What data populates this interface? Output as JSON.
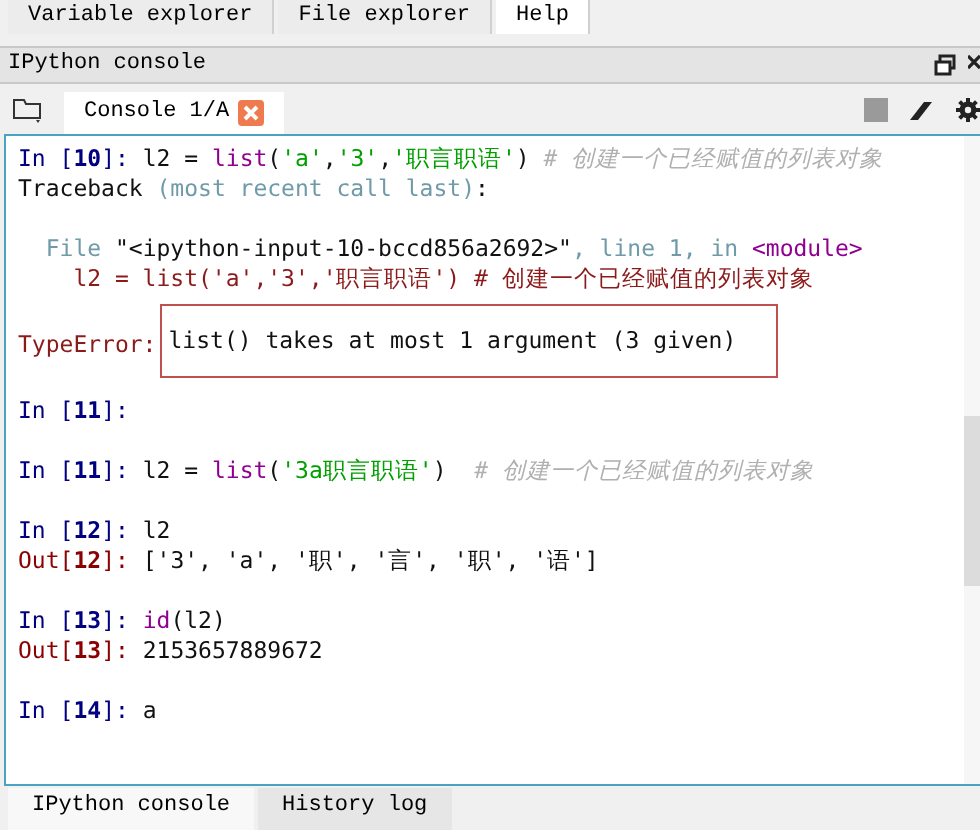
{
  "top_tabs": [
    {
      "label": "Variable explorer",
      "selected": false
    },
    {
      "label": "File explorer",
      "selected": false
    },
    {
      "label": "Help",
      "selected": true
    }
  ],
  "pane": {
    "title": "IPython console"
  },
  "console_tabs": [
    {
      "label": "Console 1/A",
      "selected": true
    }
  ],
  "console": {
    "blocks": [
      [
        {
          "kind": "code",
          "tokens": [
            {
              "kind": "in",
              "t": "In [**10**]: "
            },
            {
              "kind": "plain",
              "t": "l2 = "
            },
            {
              "kind": "builtin",
              "t": "list"
            },
            {
              "kind": "plain",
              "t": "("
            },
            {
              "kind": "string",
              "t": "'a'"
            },
            {
              "kind": "plain",
              "t": ","
            },
            {
              "kind": "string",
              "t": "'3'"
            },
            {
              "kind": "plain",
              "t": ","
            },
            {
              "kind": "string",
              "t": "'职言职语'"
            },
            {
              "kind": "plain",
              "t": ") "
            },
            {
              "kind": "comment",
              "t": "# 创建一个已经赋值的列表对象"
            }
          ]
        },
        {
          "kind": "code",
          "tokens": [
            {
              "kind": "plain",
              "t": "Traceback "
            },
            {
              "kind": "dim",
              "t": "(most recent call last)"
            },
            {
              "kind": "plain",
              "t": ":"
            }
          ]
        }
      ],
      [
        {
          "kind": "code",
          "tokens": [
            {
              "kind": "dim",
              "t": "  File "
            },
            {
              "kind": "plain",
              "t": "\"<ipython-input-10-bccd856a2692>\""
            },
            {
              "kind": "dim",
              "t": ", line 1, in "
            },
            {
              "kind": "builtin",
              "t": "<module>"
            }
          ]
        },
        {
          "kind": "code",
          "tokens": [
            {
              "kind": "error",
              "t": "    l2 = list('a','3','职言职语') # 创建一个已经赋值的列表对象"
            }
          ]
        }
      ],
      [
        {
          "kind": "error",
          "label": "TypeError:",
          "message": "list() takes at most 1 argument (3 given)",
          "boxed": true
        }
      ],
      [
        {
          "kind": "code",
          "tokens": [
            {
              "kind": "in",
              "t": "In [**11**]:"
            }
          ]
        }
      ],
      [
        {
          "kind": "code",
          "tokens": [
            {
              "kind": "in",
              "t": "In [**11**]: "
            },
            {
              "kind": "plain",
              "t": "l2 = "
            },
            {
              "kind": "builtin",
              "t": "list"
            },
            {
              "kind": "plain",
              "t": "("
            },
            {
              "kind": "string",
              "t": "'3a职言职语'"
            },
            {
              "kind": "plain",
              "t": ")  "
            },
            {
              "kind": "comment",
              "t": "# 创建一个已经赋值的列表对象"
            }
          ]
        }
      ],
      [
        {
          "kind": "code",
          "tokens": [
            {
              "kind": "in",
              "t": "In [**12**]: "
            },
            {
              "kind": "plain",
              "t": "l2"
            }
          ]
        },
        {
          "kind": "code",
          "tokens": [
            {
              "kind": "out",
              "t": "Out[**12**]: "
            },
            {
              "kind": "plain",
              "t": "['3', 'a', '职', '言', '职', '语']"
            }
          ]
        }
      ],
      [
        {
          "kind": "code",
          "tokens": [
            {
              "kind": "in",
              "t": "In [**13**]: "
            },
            {
              "kind": "builtin",
              "t": "id"
            },
            {
              "kind": "plain",
              "t": "(l2)"
            }
          ]
        },
        {
          "kind": "code",
          "tokens": [
            {
              "kind": "out",
              "t": "Out[**13**]: "
            },
            {
              "kind": "plain",
              "t": "2153657889672"
            }
          ]
        }
      ],
      [
        {
          "kind": "code",
          "tokens": [
            {
              "kind": "in",
              "t": "In [**14**]: "
            },
            {
              "kind": "plain",
              "t": "a"
            }
          ]
        }
      ]
    ]
  },
  "bottom_tabs": [
    {
      "label": "IPython console",
      "selected": true
    },
    {
      "label": "History log",
      "selected": false
    }
  ]
}
